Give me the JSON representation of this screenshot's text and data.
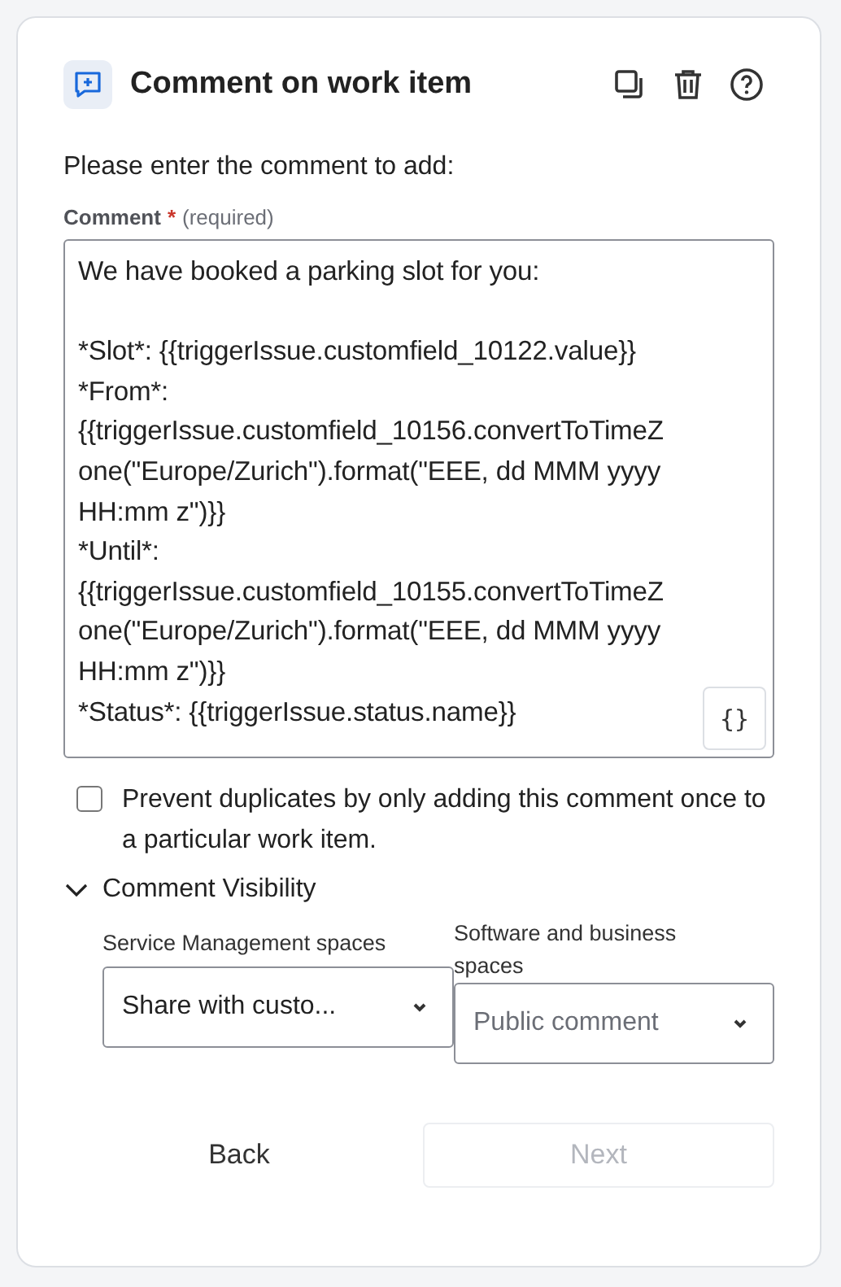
{
  "header": {
    "title": "Comment on work item"
  },
  "prompt": "Please enter the comment to add:",
  "comment_field": {
    "label": "Comment",
    "required_mark": "*",
    "required_note": "(required)",
    "value": "We have booked a parking slot for you:\n\n*Slot*: {{triggerIssue.customfield_10122.value}}\n*From*:\n{{triggerIssue.customfield_10156.convertToTimeZ\none(\"Europe/Zurich\").format(\"EEE, dd MMM yyyy\nHH:mm z\")}}\n*Until*:\n{{triggerIssue.customfield_10155.convertToTimeZ\none(\"Europe/Zurich\").format(\"EEE, dd MMM yyyy\nHH:mm z\")}}\n*Status*: {{triggerIssue.status.name}}",
    "smart_value_button": "{}"
  },
  "prevent_duplicates": {
    "label": "Prevent duplicates by only adding this comment once to a particular work item.",
    "checked": false
  },
  "visibility": {
    "title": "Comment Visibility",
    "expanded": true,
    "selects": [
      {
        "label": "Service Management spaces",
        "value": "Share with custo..."
      },
      {
        "label": "Software and business spaces",
        "value": "Public comment"
      }
    ]
  },
  "buttons": [
    {
      "label": "Back",
      "kind": "subtle",
      "disabled": false
    },
    {
      "label": "Next",
      "kind": "primary",
      "disabled": true
    }
  ]
}
